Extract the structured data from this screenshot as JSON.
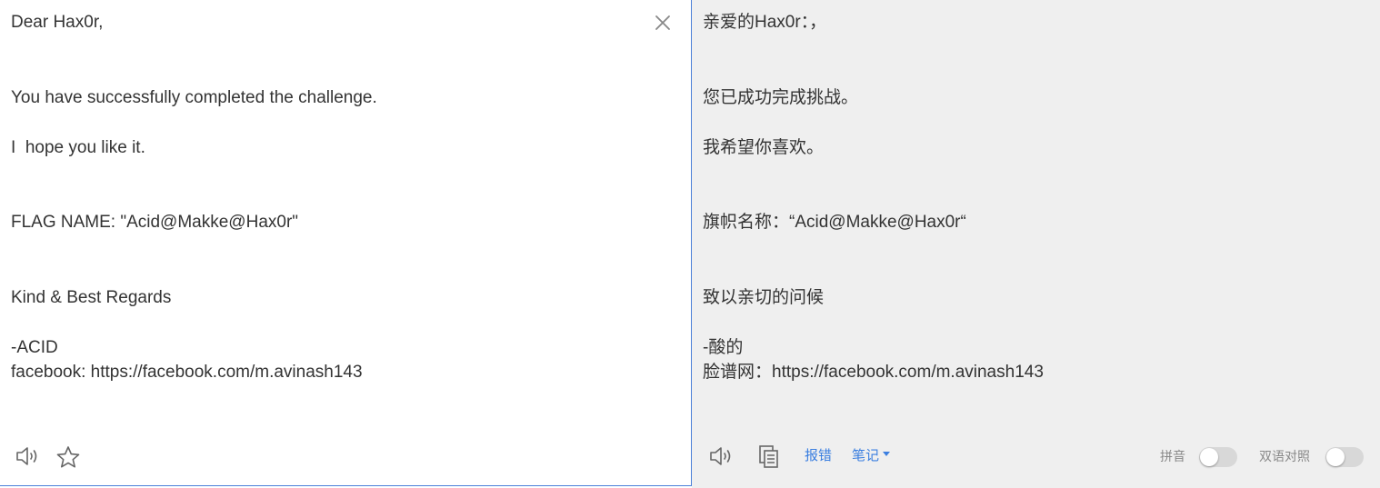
{
  "source": {
    "lines": [
      "Dear Hax0r,",
      "You have successfully completed the challenge.",
      "I  hope you like it.",
      "FLAG NAME: \"Acid@Makke@Hax0r\"",
      "Kind & Best Regards",
      "-ACID",
      "facebook: https://facebook.com/m.avinash143"
    ]
  },
  "translation": {
    "lines": [
      "亲爱的Hax0r：，",
      "您已成功完成挑战。",
      "我希望你喜欢。",
      "旗帜名称：“Acid@Makke@Hax0r“",
      "致以亲切的问候",
      "-酸的",
      "脸谱网：https://facebook.com/m.avinash143"
    ]
  },
  "toolbar": {
    "report_error": "报错",
    "notes": "笔记",
    "pinyin_label": "拼音",
    "bilingual_label": "双语对照"
  },
  "toggles": {
    "pinyin_on": false,
    "bilingual_on": false
  },
  "colors": {
    "accent": "#3b7fe0",
    "border": "#4a7fd8",
    "translation_bg": "#efefef",
    "text": "#333333",
    "icon": "#666666"
  }
}
